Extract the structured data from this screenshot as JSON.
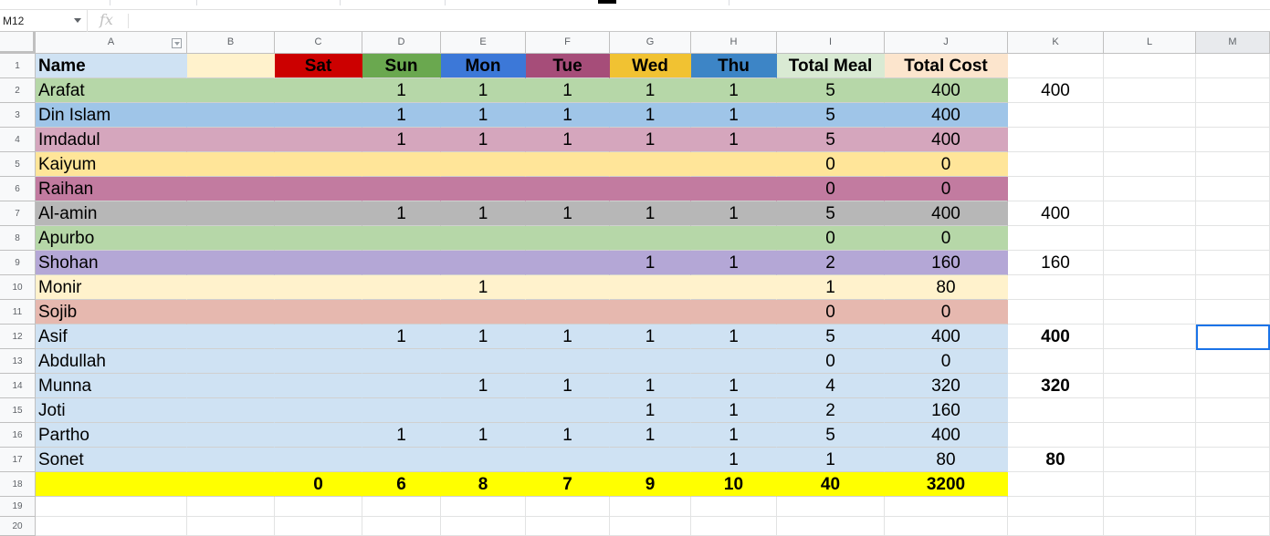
{
  "name_box": {
    "value": "M12"
  },
  "formula_bar": {
    "fx_label": "fx",
    "value": ""
  },
  "columns": [
    "A",
    "B",
    "C",
    "D",
    "E",
    "F",
    "G",
    "H",
    "I",
    "J",
    "K",
    "L",
    "M"
  ],
  "rows": [
    {
      "n": "1",
      "cells": [
        "Name",
        "",
        "Sat",
        "Sun",
        "Mon",
        "Tue",
        "Wed",
        "Thu",
        "Total Meal",
        "Total Cost",
        "",
        "",
        ""
      ]
    },
    {
      "n": "2",
      "cells": [
        "Arafat",
        "",
        "",
        "1",
        "1",
        "1",
        "1",
        "1",
        "5",
        "400",
        "400",
        "",
        ""
      ]
    },
    {
      "n": "3",
      "cells": [
        "Din Islam",
        "",
        "",
        "1",
        "1",
        "1",
        "1",
        "1",
        "5",
        "400",
        "",
        "",
        ""
      ]
    },
    {
      "n": "4",
      "cells": [
        "Imdadul",
        "",
        "",
        "1",
        "1",
        "1",
        "1",
        "1",
        "5",
        "400",
        "",
        "",
        ""
      ]
    },
    {
      "n": "5",
      "cells": [
        "Kaiyum",
        "",
        "",
        "",
        "",
        "",
        "",
        "",
        "0",
        "0",
        "",
        "",
        ""
      ]
    },
    {
      "n": "6",
      "cells": [
        "Raihan",
        "",
        "",
        "",
        "",
        "",
        "",
        "",
        "0",
        "0",
        "",
        "",
        ""
      ]
    },
    {
      "n": "7",
      "cells": [
        "Al-amin",
        "",
        "",
        "1",
        "1",
        "1",
        "1",
        "1",
        "5",
        "400",
        "400",
        "",
        ""
      ]
    },
    {
      "n": "8",
      "cells": [
        "Apurbo",
        "",
        "",
        "",
        "",
        "",
        "",
        "",
        "0",
        "0",
        "",
        "",
        ""
      ]
    },
    {
      "n": "9",
      "cells": [
        "Shohan",
        "",
        "",
        "",
        "",
        "",
        "1",
        "1",
        "2",
        "160",
        "160",
        "",
        ""
      ]
    },
    {
      "n": "10",
      "cells": [
        "Monir",
        "",
        "",
        "",
        "1",
        "",
        "",
        "",
        "1",
        "80",
        "",
        "",
        ""
      ]
    },
    {
      "n": "11",
      "cells": [
        "Sojib",
        "",
        "",
        "",
        "",
        "",
        "",
        "",
        "0",
        "0",
        "",
        "",
        ""
      ]
    },
    {
      "n": "12",
      "cells": [
        "Asif",
        "",
        "",
        "1",
        "1",
        "1",
        "1",
        "1",
        "5",
        "400",
        "400",
        "",
        ""
      ]
    },
    {
      "n": "13",
      "cells": [
        "Abdullah",
        "",
        "",
        "",
        "",
        "",
        "",
        "",
        "0",
        "0",
        "",
        "",
        ""
      ]
    },
    {
      "n": "14",
      "cells": [
        "Munna",
        "",
        "",
        "",
        "1",
        "1",
        "1",
        "1",
        "4",
        "320",
        "320",
        "",
        ""
      ]
    },
    {
      "n": "15",
      "cells": [
        "Joti",
        "",
        "",
        "",
        "",
        "",
        "1",
        "1",
        "2",
        "160",
        "",
        "",
        ""
      ]
    },
    {
      "n": "16",
      "cells": [
        "Partho",
        "",
        "",
        "1",
        "1",
        "1",
        "1",
        "1",
        "5",
        "400",
        "",
        "",
        ""
      ]
    },
    {
      "n": "17",
      "cells": [
        "Sonet",
        "",
        "",
        "",
        "",
        "",
        "",
        "1",
        "1",
        "80",
        "80",
        "",
        ""
      ]
    },
    {
      "n": "18",
      "cells": [
        "",
        "",
        "0",
        "6",
        "8",
        "7",
        "9",
        "10",
        "40",
        "3200",
        "",
        "",
        ""
      ]
    },
    {
      "n": "19",
      "cells": [
        "",
        "",
        "",
        "",
        "",
        "",
        "",
        "",
        "",
        "",
        "",
        "",
        ""
      ]
    },
    {
      "n": "20",
      "cells": [
        "",
        "",
        "",
        "",
        "",
        "",
        "",
        "",
        "",
        "",
        "",
        "",
        ""
      ]
    }
  ],
  "colors": {
    "header_name": "#cfe2f3",
    "header_b": "#fff2cc",
    "sat": "#cc0000",
    "sun": "#6aa84f",
    "mon": "#3c78d8",
    "tue": "#a64d79",
    "wed": "#f1c232",
    "thu": "#3d85c6",
    "total_meal": "#d9ead3",
    "total_cost": "#fce5cd",
    "totals_row": "#ffff00",
    "row_fills": [
      "#b6d7a8",
      "#9fc5e8",
      "#d5a6bd",
      "#ffe599",
      "#c27ba0",
      "#b7b7b7",
      "#b6d7a8",
      "#b4a7d6",
      "#fff2cc",
      "#e6b8af",
      "#cfe2f3",
      "#cfe2f3",
      "#cfe2f3",
      "#cfe2f3",
      "#cfe2f3",
      "#cfe2f3"
    ],
    "selection": "#1a73e8"
  },
  "selected_cell": "M12"
}
